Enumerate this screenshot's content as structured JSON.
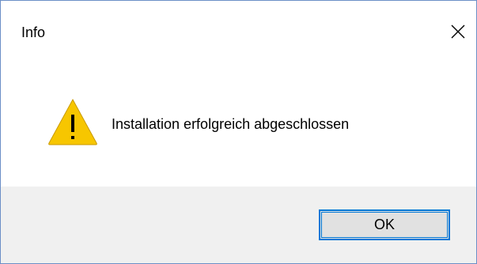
{
  "window": {
    "title": "Info",
    "close_icon": "close-icon"
  },
  "message": {
    "icon": "warning-icon",
    "text": "Installation erfolgreich abgeschlossen"
  },
  "buttons": {
    "ok_label": "OK"
  },
  "colors": {
    "accent": "#0078d7",
    "warning_fill": "#f7c600",
    "footer_bg": "#f0f0f0"
  }
}
